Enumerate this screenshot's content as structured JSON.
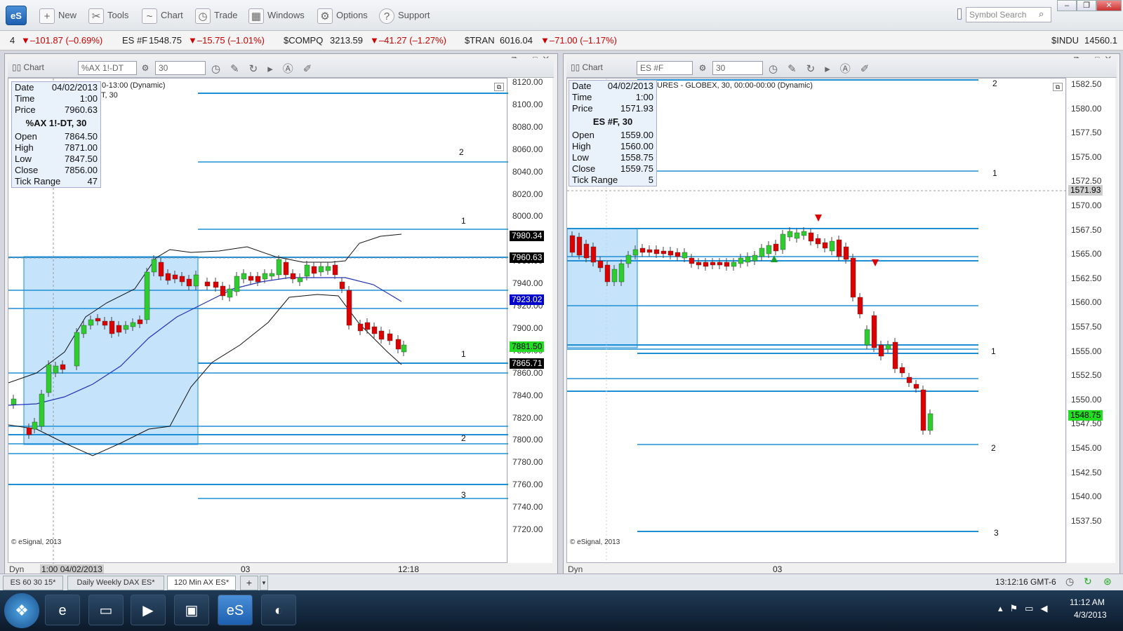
{
  "toolbar": {
    "new": "New",
    "tools": "Tools",
    "chart": "Chart",
    "trade": "Trade",
    "windows": "Windows",
    "options": "Options",
    "support": "Support",
    "search_placeholder": "Symbol Search",
    "logo": "eS"
  },
  "ticker": [
    {
      "sym": "4",
      "price": "",
      "chg": "▼–101.87 (–0.69%)"
    },
    {
      "sym": "ES #F",
      "price": "1548.75",
      "chg": "▼–15.75 (–1.01%)"
    },
    {
      "sym": "$COMPQ",
      "price": "3213.59",
      "chg": "▼–41.27 (–1.27%)"
    },
    {
      "sym": "$TRAN",
      "price": "6016.04",
      "chg": "▼–71.00 (–1.17%)"
    },
    {
      "sym": "$INDU",
      "price": "14560.1",
      "chg": ""
    }
  ],
  "left": {
    "chart_label": "Chart",
    "symbol": "%AX 1!-DT",
    "interval": "30",
    "header": "0-13:00 (Dynamic)",
    "header2": "DT, 30",
    "info": {
      "date_l": "Date",
      "date": "04/02/2013",
      "time_l": "Time",
      "time": "1:00",
      "price_l": "Price",
      "price": "7960.63",
      "title": "%AX 1!-DT, 30",
      "open_l": "Open",
      "open": "7864.50",
      "high_l": "High",
      "high": "7871.00",
      "low_l": "Low",
      "low": "7847.50",
      "close_l": "Close",
      "close": "7856.00",
      "tr_l": "Tick Range",
      "tr": "47"
    },
    "yaxis": [
      "8120.00",
      "8100.00",
      "8080.00",
      "8060.00",
      "8040.00",
      "8020.00",
      "8000.00",
      "7980.00",
      "7960.00",
      "7940.00",
      "7920.00",
      "7900.00",
      "7880.00",
      "7860.00",
      "7840.00",
      "7820.00",
      "7800.00",
      "7780.00",
      "7760.00",
      "7740.00",
      "7720.00"
    ],
    "tags": {
      "t1": "7980.34",
      "t2": "7960.63",
      "t3": "7923.02",
      "t4": "7881.50",
      "t5": "7865.71"
    },
    "lbls": [
      "2",
      "1",
      "1",
      "2",
      "3"
    ],
    "copy": "© eSignal, 2013",
    "dyn": "Dyn",
    "cursor": "1:00 04/02/2013",
    "x1": "03",
    "x2": "12:18"
  },
  "right": {
    "chart_label": "Chart",
    "symbol": "ES #F",
    "interval": "30",
    "header": "URES - GLOBEX, 30, 00:00-00:00 (Dynamic)",
    "info": {
      "date_l": "Date",
      "date": "04/02/2013",
      "time_l": "Time",
      "time": "1:00",
      "price_l": "Price",
      "price": "1571.93",
      "title": "ES #F, 30",
      "open_l": "Open",
      "open": "1559.00",
      "high_l": "High",
      "high": "1560.00",
      "low_l": "Low",
      "low": "1558.75",
      "close_l": "Close",
      "close": "1559.75",
      "tr_l": "Tick Range",
      "tr": "5"
    },
    "yaxis": [
      "1582.50",
      "1580.00",
      "1577.50",
      "1575.00",
      "1572.50",
      "1570.00",
      "1567.50",
      "1565.00",
      "1562.50",
      "1560.00",
      "1557.50",
      "1555.00",
      "1552.50",
      "1550.00",
      "1547.50",
      "1545.00",
      "1542.50",
      "1540.00",
      "1537.50"
    ],
    "tags": {
      "t1": "1571.93",
      "t2": "1548.75"
    },
    "lbls": [
      "2",
      "1",
      "1",
      "2",
      "3"
    ],
    "copy": "© eSignal, 2013",
    "dyn": "Dyn",
    "x1": "03"
  },
  "tabs": [
    "ES 60 30 15*",
    "Daily Weekly DAX ES*",
    "120 Min AX ES*",
    "+"
  ],
  "status": {
    "time": "13:12:16 GMT-6"
  },
  "clock": {
    "time": "11:12 AM",
    "date": "4/3/2013"
  },
  "colors": {
    "up": "#2ecc2e",
    "down": "#dd0000",
    "level": "#1e8fd6",
    "box": "#bfe0fb"
  }
}
